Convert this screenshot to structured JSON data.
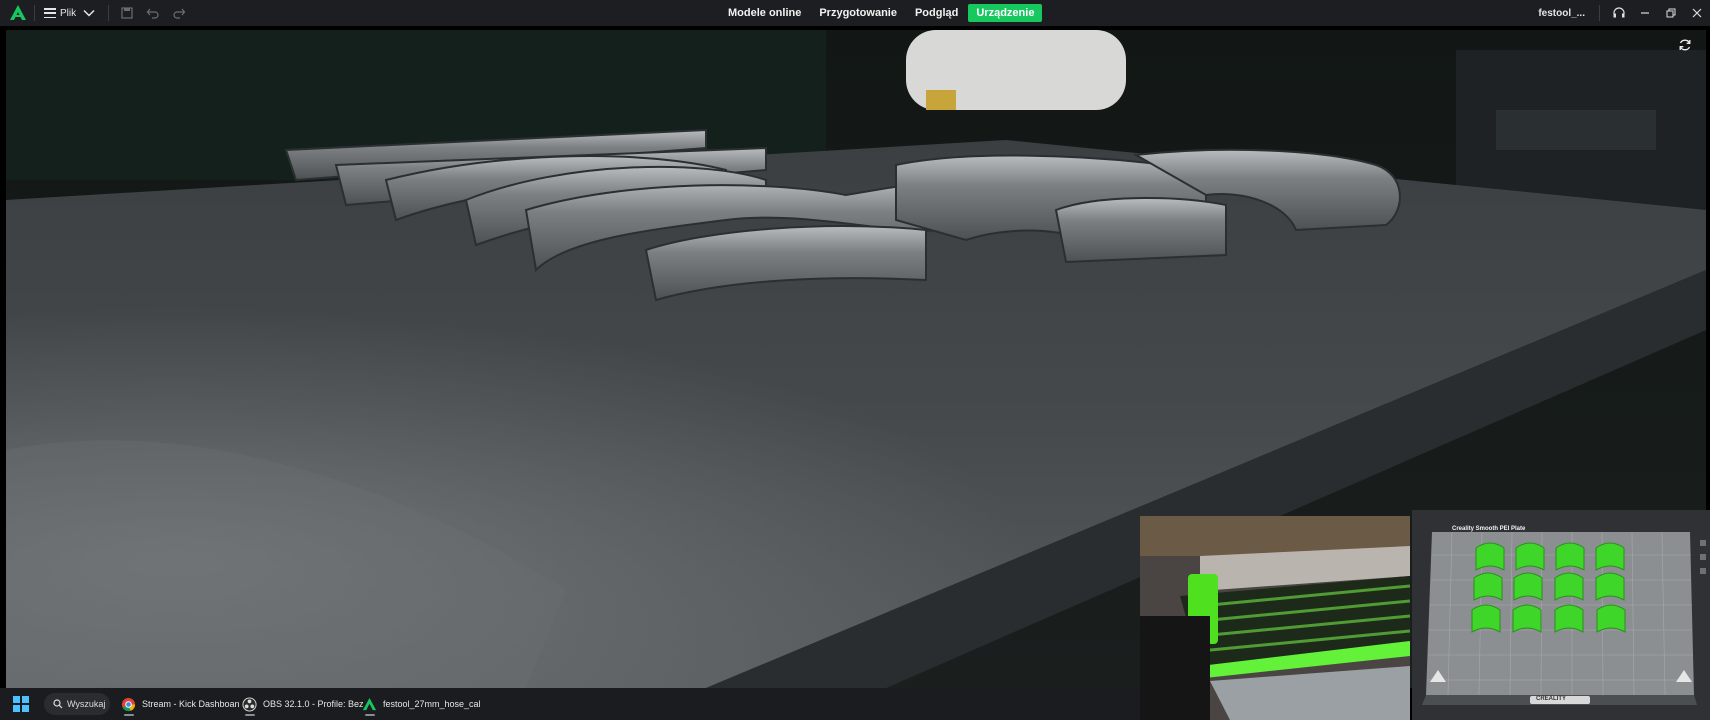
{
  "app": {
    "title_menu": "Plik",
    "file_name": "festool_...",
    "brand_color": "#17c85f"
  },
  "tabs": [
    {
      "label": "Modele online",
      "active": false
    },
    {
      "label": "Przygotowanie",
      "active": false
    },
    {
      "label": "Podgląd",
      "active": false
    },
    {
      "label": "Urządzenie",
      "active": true
    }
  ],
  "camera": {
    "pip_plate": {
      "plate_name": "Creality Smooth PEI Plate",
      "brand_text": "CREALITY"
    }
  },
  "taskbar": {
    "search_label": "Wyszukaj",
    "items": [
      {
        "label": "Stream - Kick Dashboan",
        "icon": "chrome-icon"
      },
      {
        "label": "OBS 32.1.0 - Profile: Bez",
        "icon": "obs-icon"
      },
      {
        "label": "festool_27mm_hose_cal",
        "icon": "creality-icon"
      }
    ]
  }
}
